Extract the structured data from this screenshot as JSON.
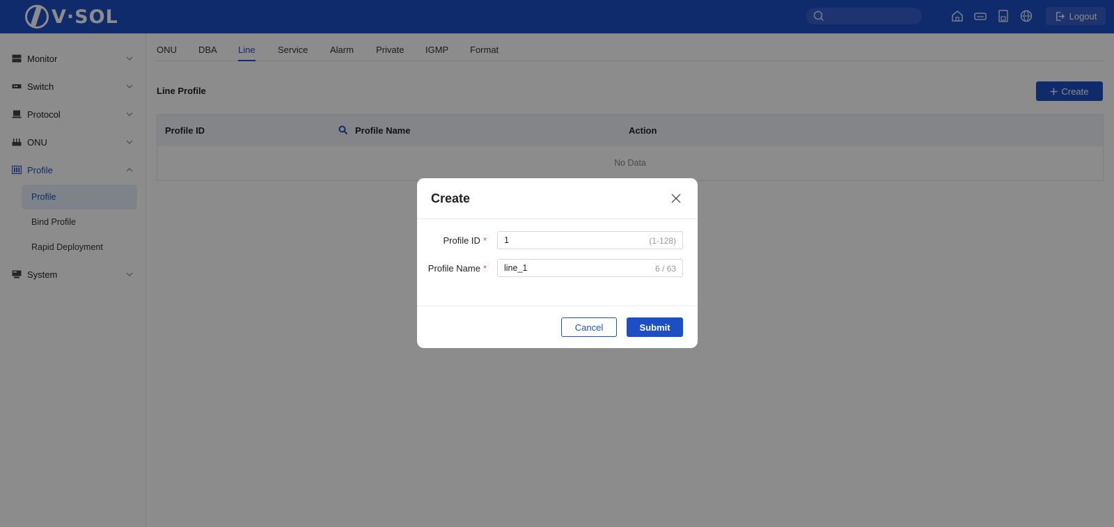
{
  "brand": {
    "logo_text": "V·SOL"
  },
  "header": {
    "search_placeholder": "",
    "icons": [
      "home-icon",
      "device-icon",
      "save-icon",
      "globe-icon"
    ],
    "logout_label": "Logout"
  },
  "sidebar": {
    "items": [
      {
        "label": "Monitor",
        "icon": "monitor-icon",
        "expanded": false
      },
      {
        "label": "Switch",
        "icon": "switch-icon",
        "expanded": false
      },
      {
        "label": "Protocol",
        "icon": "protocol-icon",
        "expanded": false
      },
      {
        "label": "ONU",
        "icon": "onu-icon",
        "expanded": false
      },
      {
        "label": "Profile",
        "icon": "profile-icon",
        "expanded": true,
        "active": true
      },
      {
        "label": "System",
        "icon": "system-icon",
        "expanded": false
      }
    ],
    "profile_sub": [
      {
        "label": "Profile",
        "selected": true
      },
      {
        "label": "Bind Profile",
        "selected": false
      },
      {
        "label": "Rapid Deployment",
        "selected": false
      }
    ]
  },
  "tabs": [
    {
      "label": "ONU"
    },
    {
      "label": "DBA"
    },
    {
      "label": "Line",
      "active": true
    },
    {
      "label": "Service"
    },
    {
      "label": "Alarm"
    },
    {
      "label": "Private"
    },
    {
      "label": "IGMP"
    },
    {
      "label": "Format"
    }
  ],
  "section": {
    "title": "Line Profile",
    "create_label": "Create"
  },
  "table": {
    "columns": [
      "Profile ID",
      "Profile Name",
      "Action"
    ],
    "empty_text": "No Data"
  },
  "modal": {
    "title": "Create",
    "fields": [
      {
        "label": "Profile ID",
        "required": true,
        "value": "1",
        "suffix": "(1-128)"
      },
      {
        "label": "Profile Name",
        "required": true,
        "value": "line_1",
        "suffix": "6 / 63"
      }
    ],
    "cancel_label": "Cancel",
    "submit_label": "Submit"
  },
  "colors": {
    "primary": "#1d4fc4",
    "required": "#e34d4d",
    "overlay": "rgba(0,0,0,0.45)"
  }
}
